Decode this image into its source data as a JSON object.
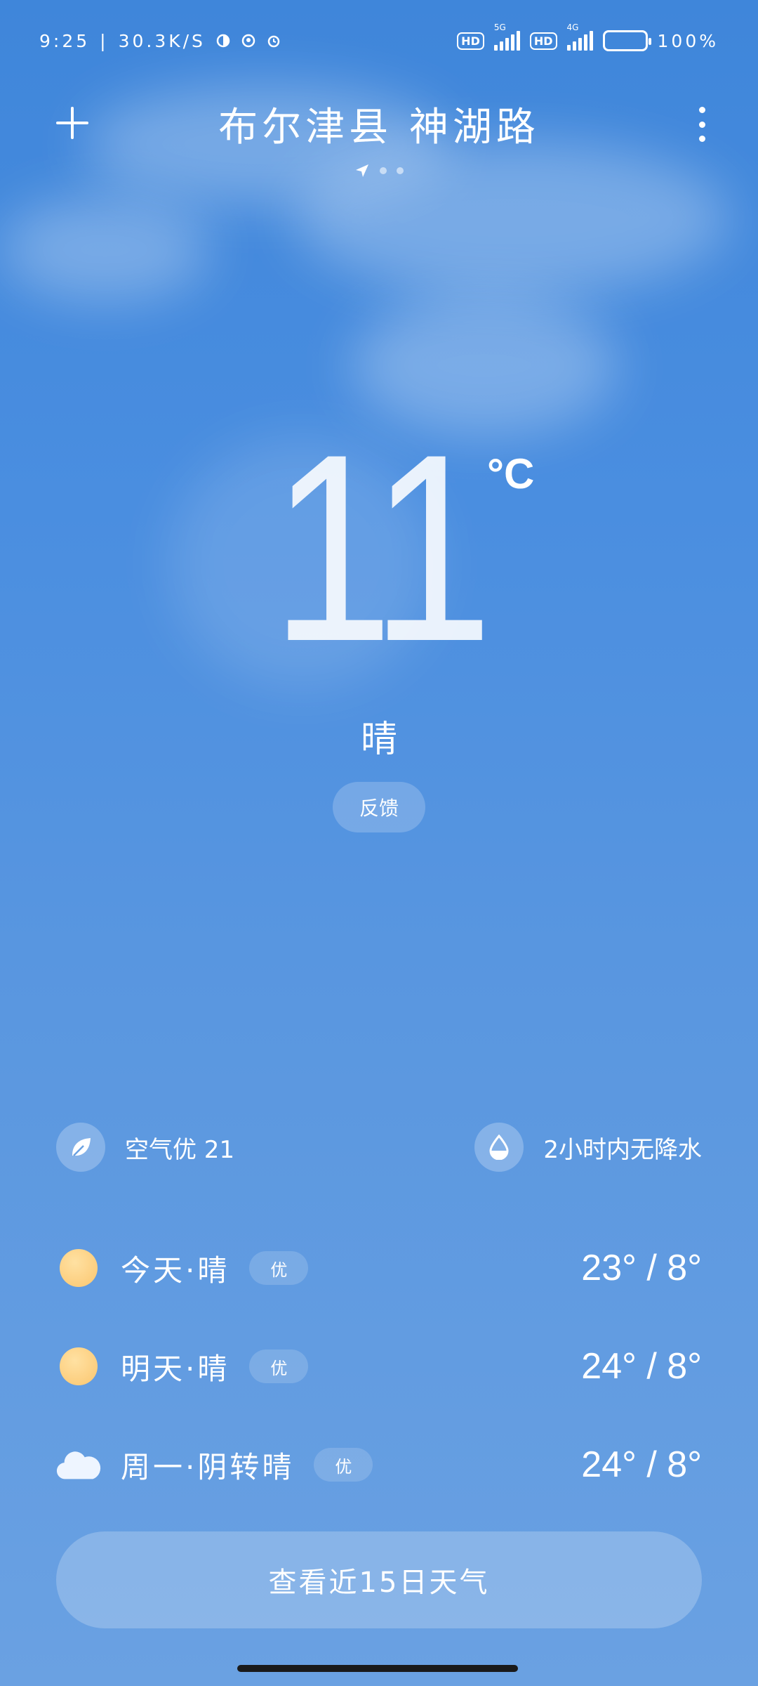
{
  "status_bar": {
    "time": "9:25",
    "separator": "|",
    "net_speed": "30.3K/S",
    "hd_label": "HD",
    "sim1_tag": "5G",
    "sim2_tag": "4G",
    "battery": "100%"
  },
  "header": {
    "location": "布尔津县 神湖路",
    "page_count": 3,
    "active_page": 0
  },
  "current": {
    "temperature": "11",
    "unit": "°C",
    "condition": "晴",
    "feedback_label": "反馈"
  },
  "info": {
    "air_quality": "空气优 21",
    "precipitation": "2小时内无降水"
  },
  "forecast": [
    {
      "label": "今天·晴",
      "badge": "优",
      "temp": "23° / 8°",
      "icon": "sun-icon"
    },
    {
      "label": "明天·晴",
      "badge": "优",
      "temp": "24° / 8°",
      "icon": "sun-icon"
    },
    {
      "label": "周一·阴转晴",
      "badge": "优",
      "temp": "24° / 8°",
      "icon": "cloud-icon"
    }
  ],
  "cta": {
    "label": "查看近15日天气"
  },
  "colors": {
    "sky_top": "#3f86da",
    "sky_bottom": "#6aa1e2",
    "sun": "#fbc66f"
  }
}
